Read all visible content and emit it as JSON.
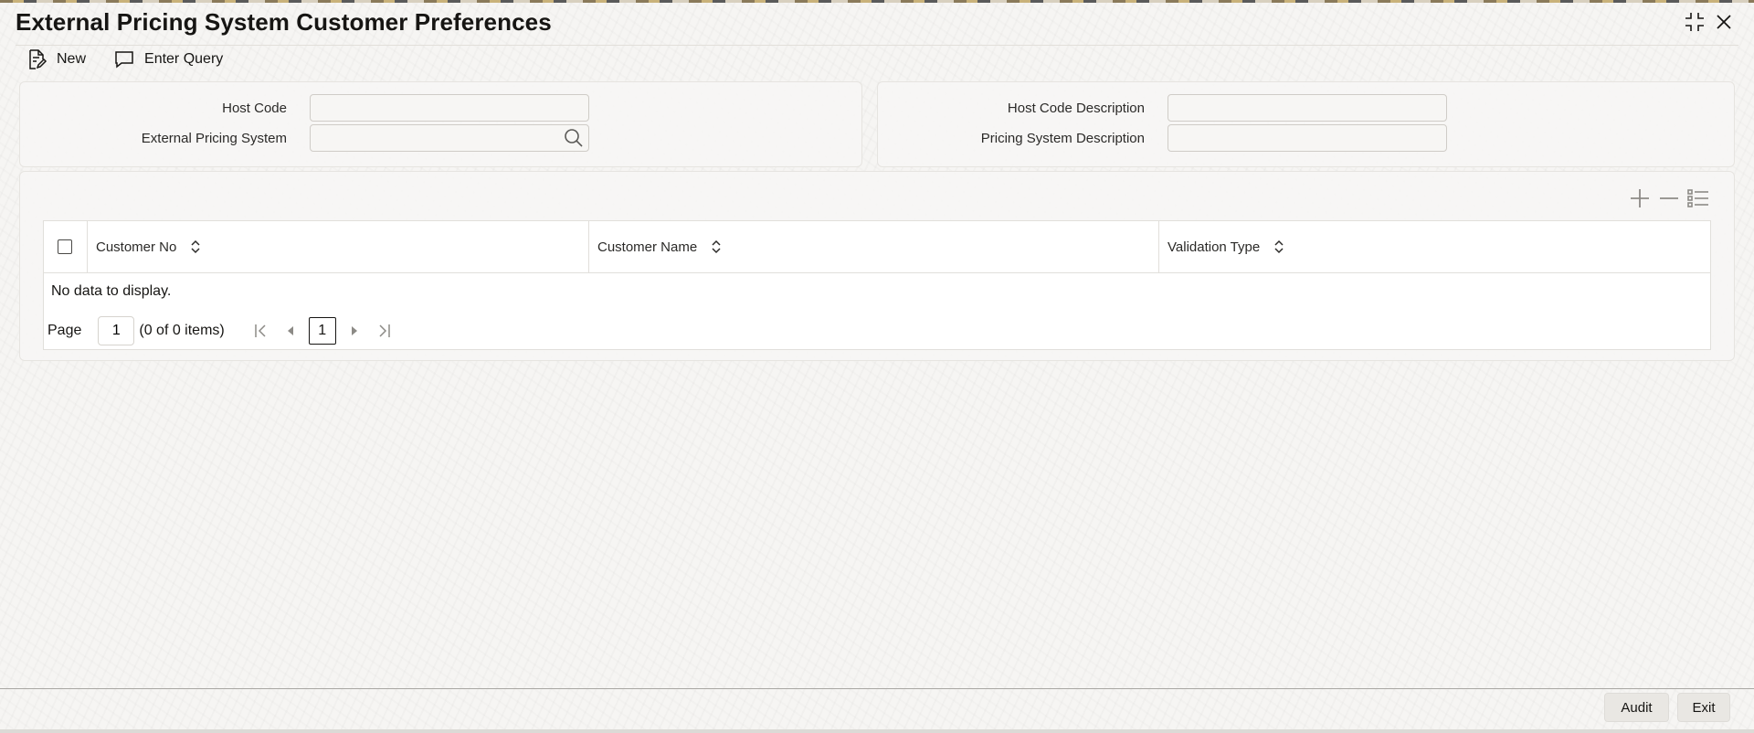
{
  "window": {
    "title": "External Pricing System Customer Preferences",
    "maximize_icon": "maximize-icon",
    "close_icon": "close-icon"
  },
  "toolbar": {
    "new_label": "New",
    "new_icon": "new-document-icon",
    "enter_query_label": "Enter Query",
    "enter_query_icon": "query-chat-icon"
  },
  "form": {
    "host_code_label": "Host Code",
    "host_code_value": "",
    "external_pricing_system_label": "External Pricing System",
    "external_pricing_system_value": "",
    "host_code_description_label": "Host Code Description",
    "host_code_description_value": "",
    "pricing_system_description_label": "Pricing System Description",
    "pricing_system_description_value": ""
  },
  "grid": {
    "tool_icons": [
      "add-row-icon",
      "remove-row-icon",
      "columns-list-icon"
    ],
    "columns": [
      "Customer No",
      "Customer Name",
      "Validation Type"
    ],
    "rows": [],
    "empty_text": "No data to display.",
    "pager": {
      "page_label": "Page",
      "page_value": "1",
      "summary": "(0 of 0 items)",
      "current_page": "1"
    }
  },
  "footer": {
    "audit_label": "Audit",
    "exit_label": "Exit"
  },
  "colors": {
    "text": "#161513",
    "background": "#f6f5f3",
    "border": "#e1dfdb",
    "button": "#e9e7e3"
  }
}
